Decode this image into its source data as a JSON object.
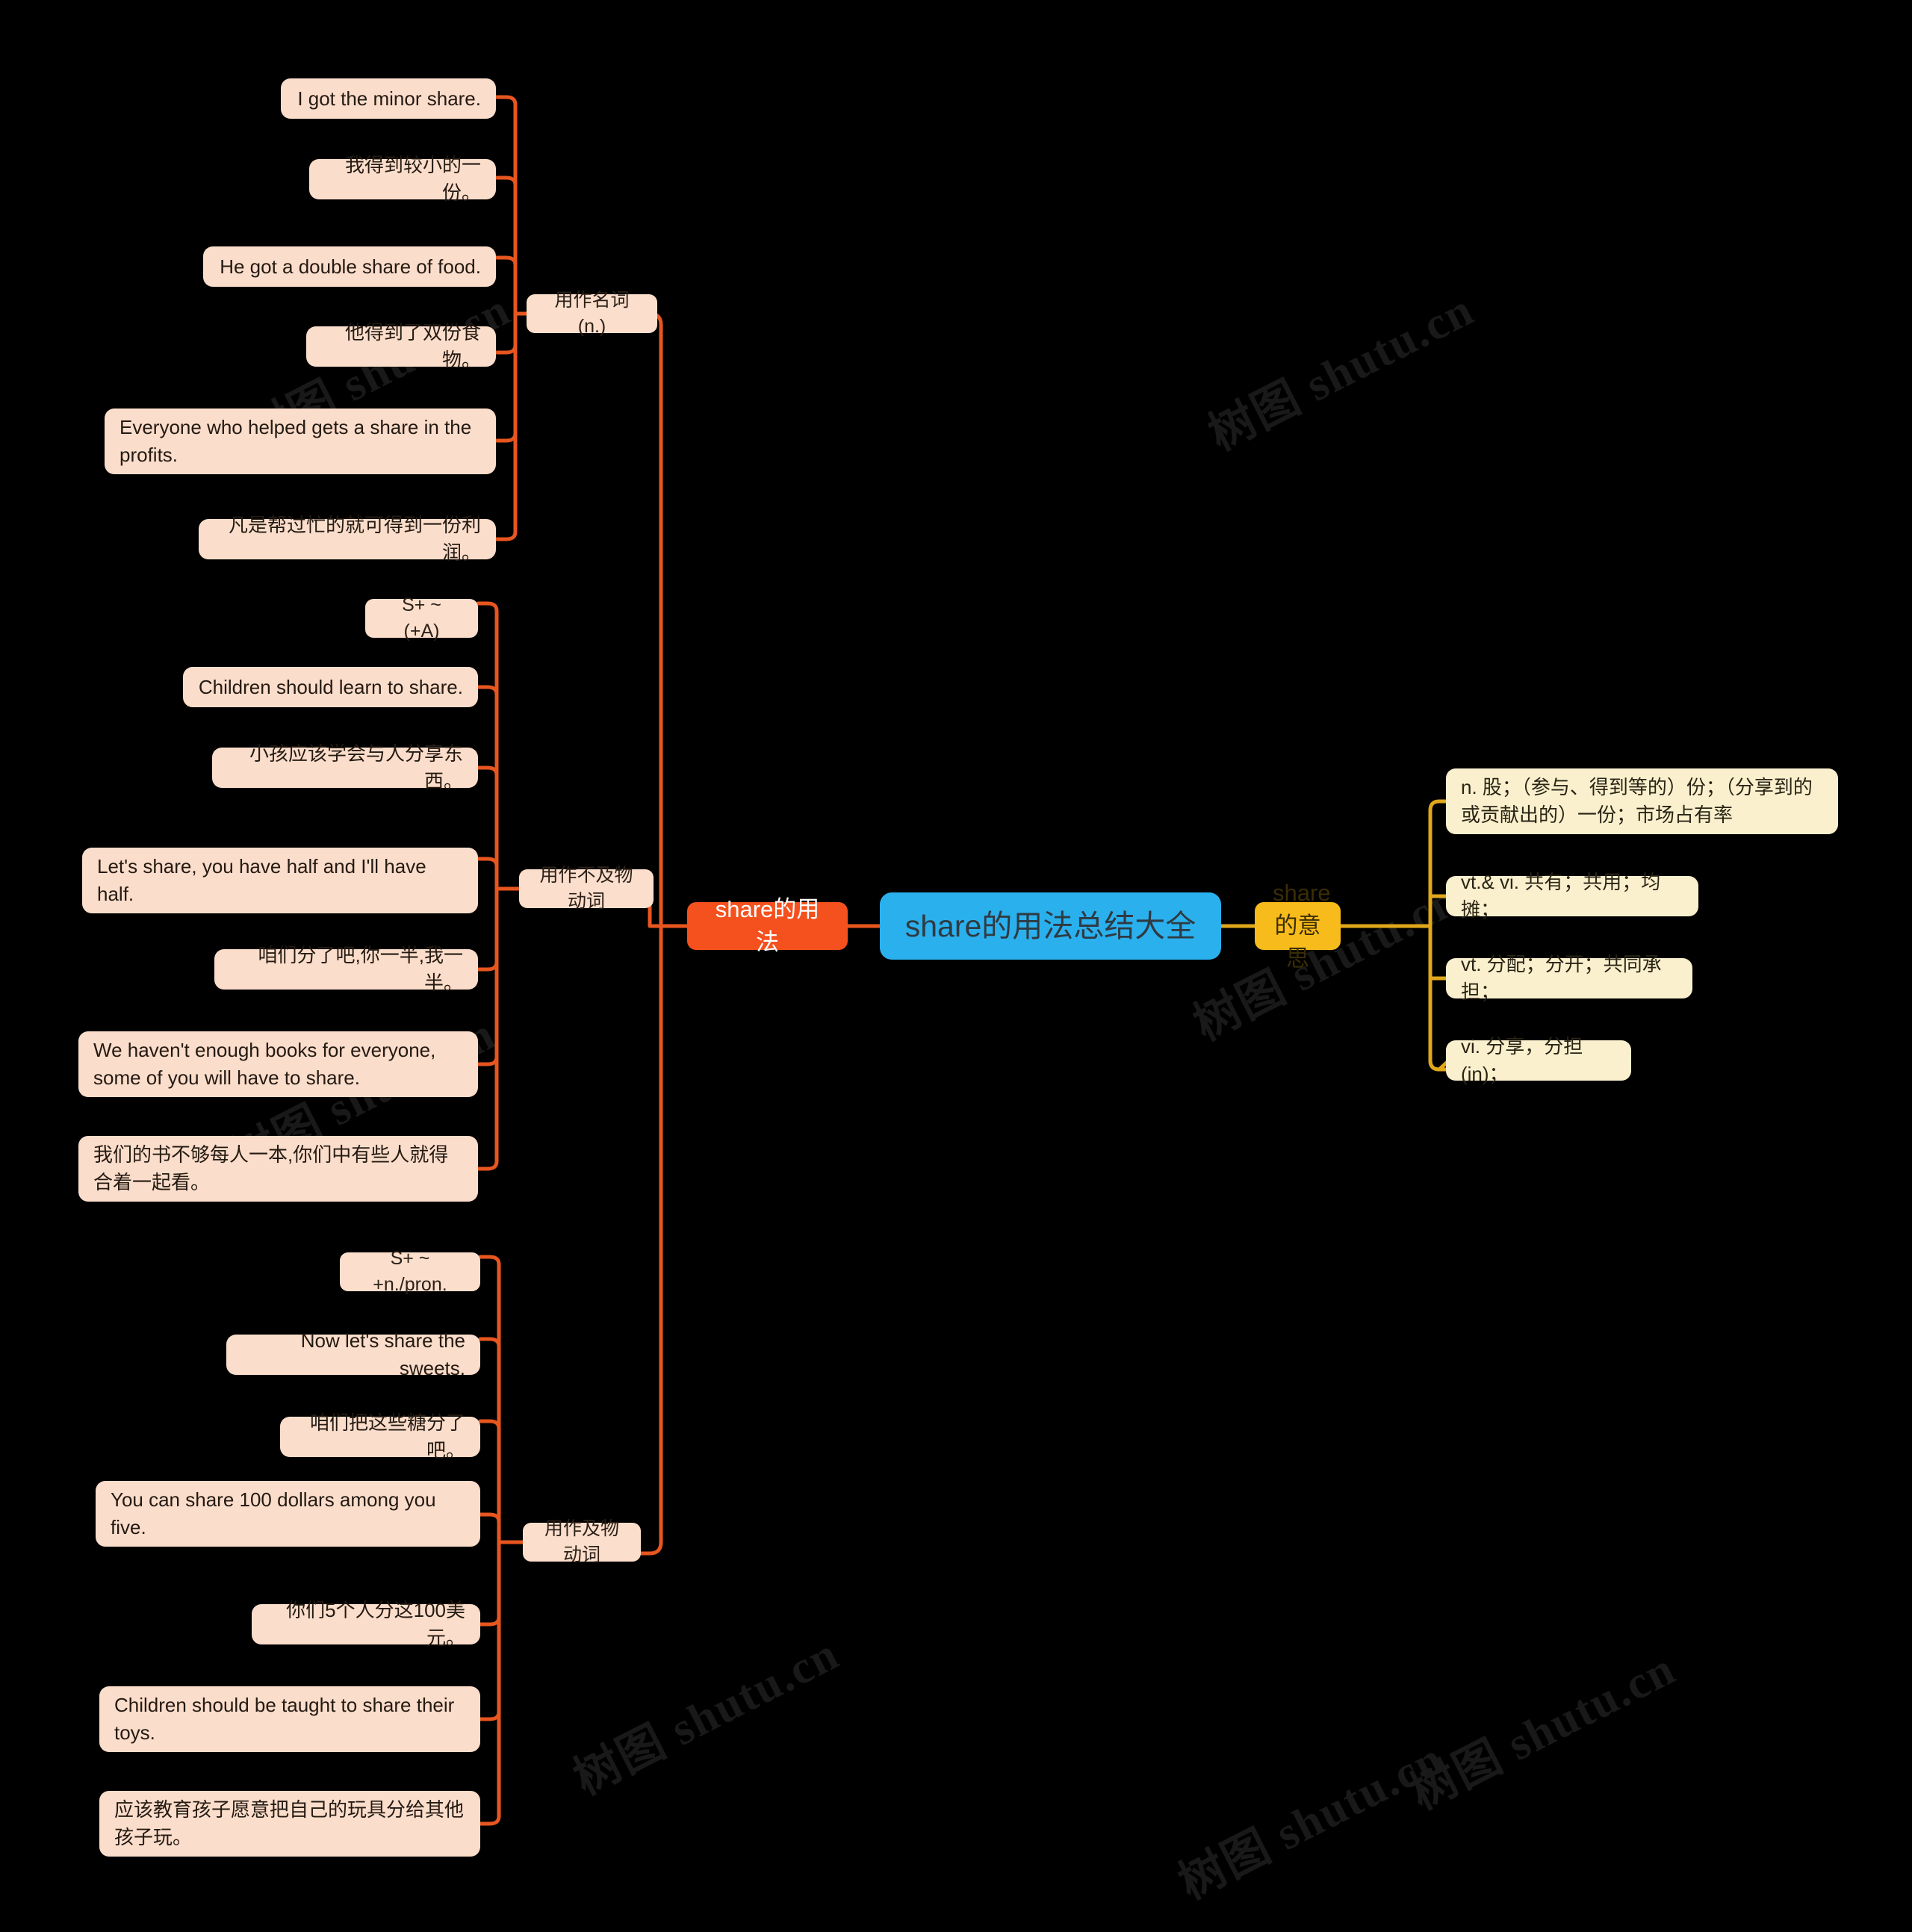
{
  "title": "share的用法总结大全",
  "colors": {
    "background": "#000000",
    "root": "#2BB0EE",
    "usage_branch": "#F4511E",
    "meaning_branch": "#F7BB1C",
    "example_box": "#FBDDCB",
    "meaning_box": "#FAF0CE",
    "usage_link": "#E8561F",
    "meaning_link": "#E0A81A"
  },
  "watermark": {
    "text": "树图 shutu.cn"
  },
  "root": {
    "label": "share的用法总结大全"
  },
  "left_branch": {
    "label": "share的用法",
    "categories": [
      {
        "label": "用作名词(n.)",
        "items": [
          {
            "text": "I got the minor share."
          },
          {
            "text": "我得到较小的一份。"
          },
          {
            "text": "He got a double share of food."
          },
          {
            "text": "他得到了双份食物。"
          },
          {
            "text": "Everyone who helped gets a share in the profits."
          },
          {
            "text": "凡是帮过忙的就可得到一份利润。"
          }
        ]
      },
      {
        "label": "用作不及物动词",
        "items": [
          {
            "text": "S+ ~ (+A)"
          },
          {
            "text": "Children should learn to share."
          },
          {
            "text": "小孩应该学会与人分享东西。"
          },
          {
            "text": "Let's share, you have half and I'll have half."
          },
          {
            "text": "咱们分了吧,你一半,我一半。"
          },
          {
            "text": "We haven't enough books for everyone, some of you will have to share."
          },
          {
            "text": "我们的书不够每人一本,你们中有些人就得合着一起看。"
          }
        ]
      },
      {
        "label": "用作及物动词",
        "items": [
          {
            "text": "S+ ~ +n./pron."
          },
          {
            "text": "Now let's share the sweets."
          },
          {
            "text": "咱们把这些糖分了吧。"
          },
          {
            "text": "You can share 100 dollars among you five."
          },
          {
            "text": "你们5个人分这100美元。"
          },
          {
            "text": "Children should be taught to share their toys."
          },
          {
            "text": "应该教育孩子愿意把自己的玩具分给其他孩子玩。"
          }
        ]
      }
    ]
  },
  "right_branch": {
    "label": "share的意思",
    "items": [
      {
        "text": "n. 股；（参与、得到等的）份；（分享到的或贡献出的）一份；市场占有率"
      },
      {
        "text": "vt.& vi. 共有；共用；均摊；"
      },
      {
        "text": "vt. 分配；分开；共同承担；"
      },
      {
        "text": "vi. 分享，分担(in)；"
      }
    ]
  }
}
